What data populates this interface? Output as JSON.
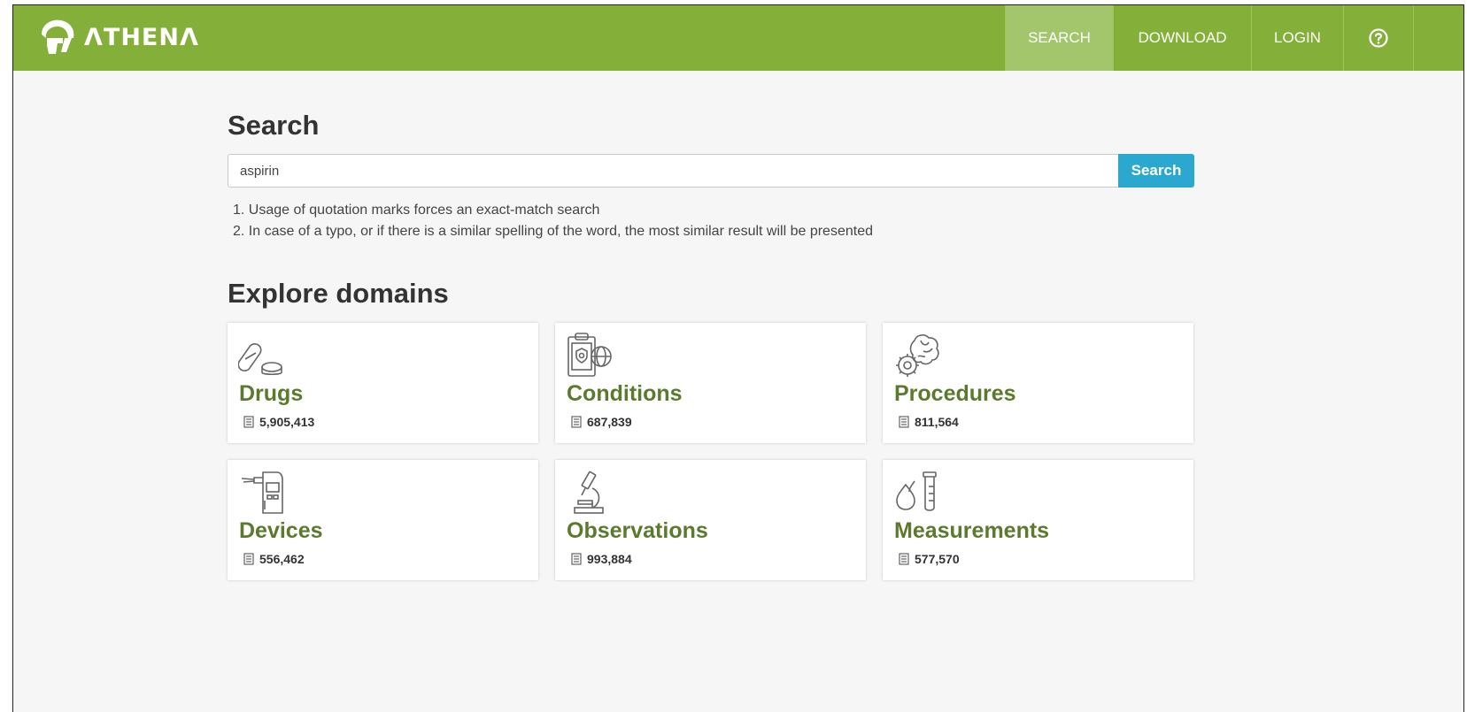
{
  "brand": {
    "name": "ΛTHENΛ"
  },
  "nav": [
    {
      "label": "SEARCH",
      "active": true
    },
    {
      "label": "DOWNLOAD",
      "active": false
    },
    {
      "label": "LOGIN",
      "active": false
    },
    {
      "label": "?",
      "icon": "help-icon"
    }
  ],
  "search": {
    "heading": "Search",
    "value": "aspirin",
    "button_label": "Search",
    "hints": [
      "1. Usage of quotation marks forces an exact-match search",
      "2. In case of a typo, or if there is a similar spelling of the word, the most similar result will be presented"
    ]
  },
  "explore": {
    "heading": "Explore domains",
    "domains": [
      {
        "name": "Drugs",
        "count": "5,905,413",
        "icon": "pill-icon"
      },
      {
        "name": "Conditions",
        "count": "687,839",
        "icon": "clipboard-globe-icon"
      },
      {
        "name": "Procedures",
        "count": "811,564",
        "icon": "brain-gear-icon"
      },
      {
        "name": "Devices",
        "count": "556,462",
        "icon": "device-icon"
      },
      {
        "name": "Observations",
        "count": "993,884",
        "icon": "microscope-icon"
      },
      {
        "name": "Measurements",
        "count": "577,570",
        "icon": "test-tube-icon"
      }
    ]
  },
  "colors": {
    "header": "#84b03a",
    "accent": "#2ba8cf",
    "title_green": "#5c7a2e"
  }
}
